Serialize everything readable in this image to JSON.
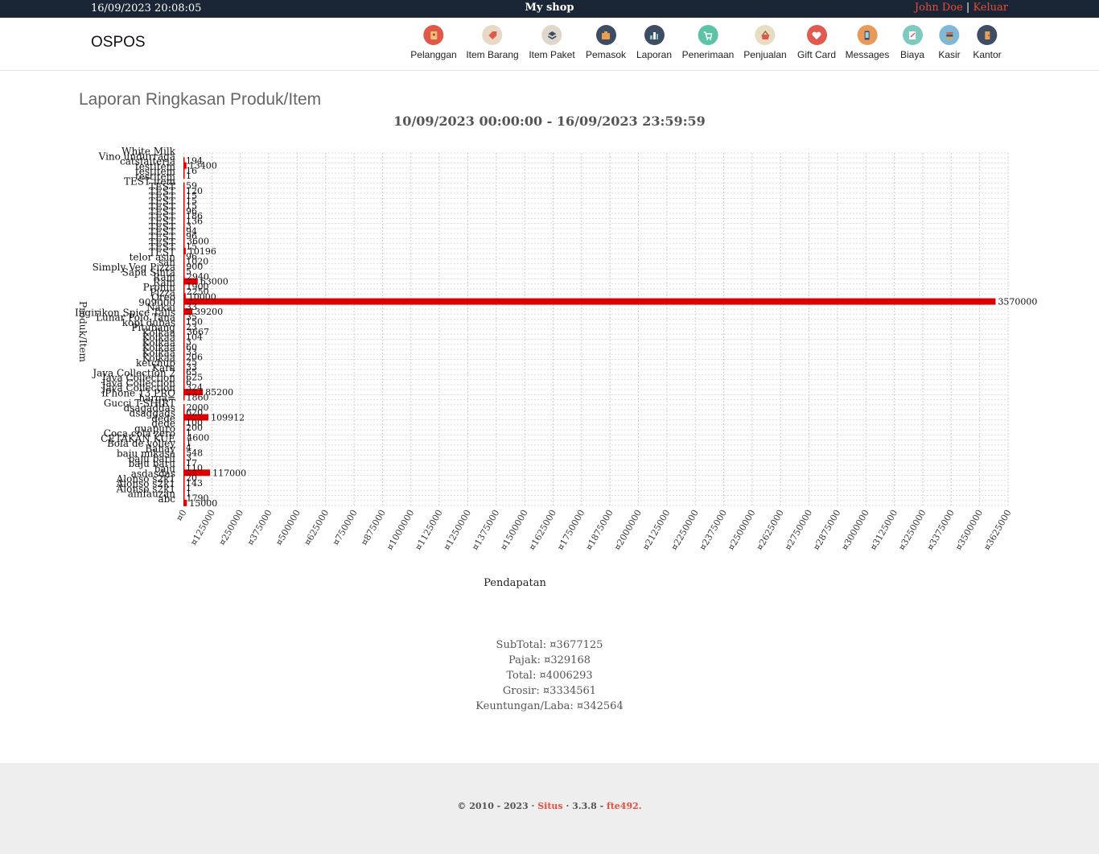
{
  "topbar": {
    "datetime": "16/09/2023 20:08:05",
    "shop_name": "My shop",
    "user_name": "John Doe",
    "separator": "|",
    "logout_label": "Keluar"
  },
  "navbar": {
    "brand": "OSPOS",
    "items": [
      {
        "label": "Pelanggan",
        "icon": "customers-icon",
        "color": "#e0584a"
      },
      {
        "label": "Item Barang",
        "icon": "tag-icon",
        "color": "#e8d9c6"
      },
      {
        "label": "Item Paket",
        "icon": "box-icon",
        "color": "#ded8cc"
      },
      {
        "label": "Pemasok",
        "icon": "briefcase-icon",
        "color": "#3e4d63"
      },
      {
        "label": "Laporan",
        "icon": "bar-chart-icon",
        "color": "#3e4d63"
      },
      {
        "label": "Penerimaan",
        "icon": "cart-icon",
        "color": "#5cc3a6"
      },
      {
        "label": "Penjualan",
        "icon": "basket-icon",
        "color": "#e8dcc3"
      },
      {
        "label": "Gift Card",
        "icon": "heart-icon",
        "color": "#e05a50"
      },
      {
        "label": "Messages",
        "icon": "phone-icon",
        "color": "#e89a5a"
      },
      {
        "label": "Biaya",
        "icon": "notepad-icon",
        "color": "#7fc9c0"
      },
      {
        "label": "Kasir",
        "icon": "books-icon",
        "color": "#7fb7d6"
      },
      {
        "label": "Kantor",
        "icon": "door-icon",
        "color": "#3e4d63"
      }
    ]
  },
  "report": {
    "title": "Laporan Ringkasan Produk/Item",
    "date_range": "10/09/2023 00:00:00 - 16/09/2023 23:59:59"
  },
  "chart_data": {
    "type": "bar",
    "orientation": "horizontal",
    "xlabel": "Pendapatan",
    "ylabel": "Produk/Item",
    "xlim": [
      0,
      3625000
    ],
    "x_tick_prefix": "¤",
    "x_ticks": [
      0,
      125000,
      250000,
      375000,
      500000,
      625000,
      750000,
      875000,
      1000000,
      1125000,
      1250000,
      1375000,
      1500000,
      1625000,
      1750000,
      1875000,
      2000000,
      2125000,
      2250000,
      2375000,
      2500000,
      2625000,
      2750000,
      2875000,
      3000000,
      3125000,
      3250000,
      3375000,
      3500000,
      3625000
    ],
    "grid": true,
    "bar_color": "#dd0000",
    "categories": [
      "White Milk",
      "Vino undurraga",
      "catsfaiteria",
      "testitem",
      "testitem",
      "testitem",
      "TEST item",
      "TEST",
      "TEST",
      "TEST",
      "TEST",
      "TEST",
      "TEST",
      "TEST",
      "TEST",
      "TEST",
      "TEST",
      "TEST",
      "TEST",
      "TEST",
      "TEST",
      "telor asin",
      "sah",
      "Simply Veg Pizza",
      "Sapu Sinta",
      "Ram",
      "Ram",
      "Pronin",
      "Pizza",
      "Oreo",
      "909000",
      "Nakai",
      "Ingirikon Spice Tails",
      "Lunar Polo Tana",
      "kopi dubas",
      "Pitubang",
      "Kolkaa",
      "Kolkaa",
      "Kolkaa",
      "Kolkaa",
      "Kolkaa",
      "Kolkaa",
      "ketchup",
      "Kara",
      "Java Collection 2",
      "Java Collection",
      "Java Collection",
      "Java Collection",
      "iPhone 13 PRO",
      "harga=",
      "Gucci T-SHIRT",
      "dsagaddas",
      "dsaggads",
      "dede",
      "dede",
      "guapuro",
      "Coca cola zero",
      "CETAKAN KUE",
      "Bola de volley",
      "Bahay",
      "baju mikasa",
      "baju baru",
      "baju baru",
      "baju",
      "asdasdas",
      "Alonso s2k1",
      "Alonso s2k1",
      "Alonso s2k1",
      "ainfauzan",
      "abc"
    ],
    "values": [
      0,
      194,
      13400,
      16,
      1,
      0,
      59,
      120,
      15,
      15,
      15,
      96,
      186,
      136,
      3,
      94,
      96,
      3600,
      15,
      10196,
      96,
      1020,
      900,
      5,
      2940,
      63000,
      1900,
      2250,
      10000,
      3570000,
      33,
      39200,
      35,
      150,
      23,
      3667,
      104,
      3,
      60,
      33,
      206,
      25,
      33,
      65,
      625,
      6,
      324,
      85200,
      1860,
      0,
      2000,
      620,
      109912,
      100,
      200,
      1,
      4600,
      1,
      4,
      548,
      3,
      17,
      110,
      117000,
      20,
      143,
      1,
      1,
      1790,
      15000
    ]
  },
  "summary": {
    "subtotal": "SubTotal: ¤3677125",
    "tax": "Pajak: ¤329168",
    "total": "Total: ¤4006293",
    "wholesale": "Grosir: ¤3334561",
    "profit": "Keuntungan/Laba: ¤342564"
  },
  "footer": {
    "copyright": "© 2010 - 2023 ·",
    "site_link": "Situs",
    "version": "· 3.3.8 -",
    "commit_link": "fte492."
  }
}
